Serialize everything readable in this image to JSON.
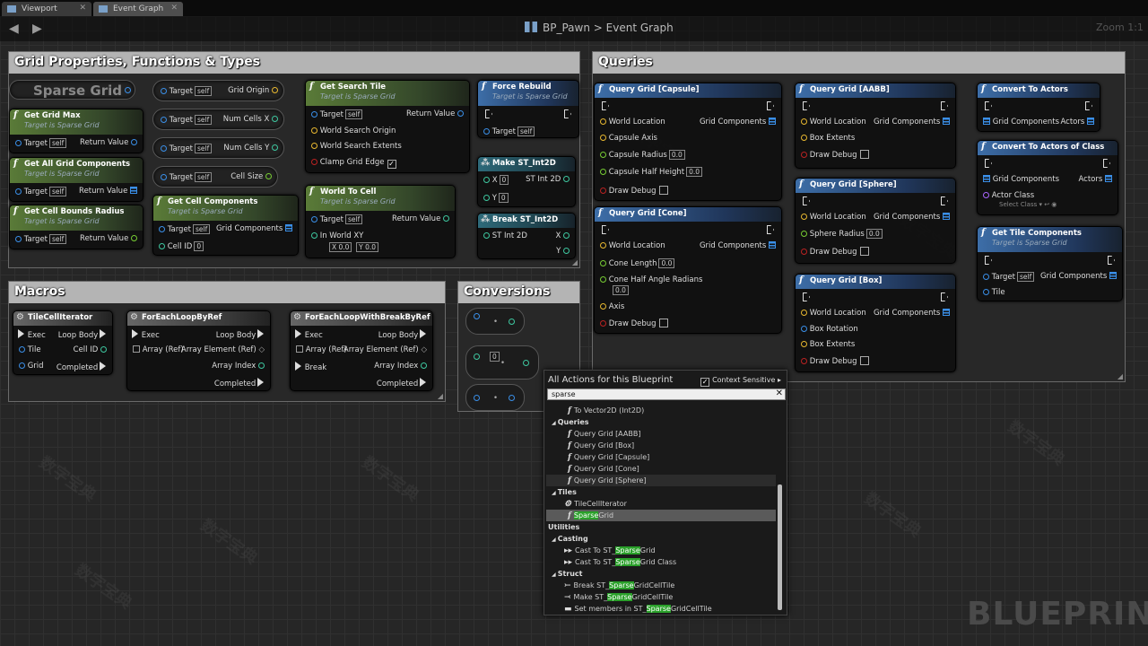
{
  "tabs": [
    {
      "label": "Viewport"
    },
    {
      "label": "Event Graph"
    }
  ],
  "breadcrumb": {
    "blueprint": "BP_Pawn",
    "separator": ">",
    "graph": "Event Graph"
  },
  "zoom": "Zoom 1:1",
  "watermark": "BLUEPRINT",
  "comments": {
    "grid": "Grid Properties, Functions & Types",
    "queries": "Queries",
    "macros": "Macros",
    "conversions": "Conversions"
  },
  "common": {
    "target": "Target",
    "self": "self",
    "return_value": "Return Value",
    "target_is": "Target is Sparse Grid",
    "exec": "Exec",
    "loop_body": "Loop Body",
    "completed": "Completed",
    "world_location": "World Location",
    "grid_components": "Grid Components",
    "draw_debug": "Draw Debug",
    "actors": "Actors"
  },
  "nodes": {
    "sparse_grid": "Sparse Grid",
    "get_grid_max": "Get Grid Max",
    "get_all_grid_components": "Get All Grid Components",
    "get_cell_bounds_radius": "Get Cell Bounds Radius",
    "grid_origin": "Grid Origin",
    "num_cells_x": "Num Cells X",
    "num_cells_y": "Num Cells Y",
    "cell_size": "Cell Size",
    "get_cell_components": "Get Cell Components",
    "cell_id": "Cell ID",
    "cell_id_val": "0",
    "get_search_tile": "Get Search Tile",
    "world_search_origin": "World Search Origin",
    "world_search_extents": "World Search Extents",
    "clamp_grid_edge": "Clamp Grid Edge",
    "world_to_cell": "World To Cell",
    "in_world_xy": "In World XY",
    "x_label": "X",
    "y_label": "Y",
    "x_val": "0.0",
    "y_val": "0.0",
    "force_rebuild": "Force Rebuild",
    "make_st_int2d": "Make ST_Int2D",
    "st_int2d": "ST Int 2D",
    "zero": "0",
    "break_st_int2d": "Break ST_Int2D",
    "qg_capsule": "Query Grid [Capsule]",
    "capsule_axis": "Capsule Axis",
    "capsule_radius": "Capsule Radius",
    "capsule_half_height": "Capsule Half Height",
    "zero_f": "0.0",
    "qg_cone": "Query Grid [Cone]",
    "cone_length": "Cone Length",
    "cone_half_angle": "Cone Half Angle Radians",
    "axis": "Axis",
    "qg_aabb": "Query Grid [AABB]",
    "box_extents": "Box Extents",
    "qg_sphere": "Query Grid [Sphere]",
    "sphere_radius": "Sphere Radius",
    "qg_box": "Query Grid [Box]",
    "box_rotation": "Box Rotation",
    "convert_to_actors": "Convert To Actors",
    "convert_to_actors_class": "Convert To Actors of Class",
    "actor_class": "Actor Class",
    "select_class": "Select Class",
    "get_tile_components": "Get Tile Components",
    "tile": "Tile",
    "tile_cell_iterator": "TileCellIterator",
    "cell_id2": "Cell ID",
    "grid": "Grid",
    "foreach_byref": "ForEachLoopByRef",
    "array_ref": "Array (Ref)",
    "array_element_ref": "Array Element (Ref)",
    "array_index": "Array Index",
    "foreach_break_byref": "ForEachLoopWithBreakByRef",
    "break": "Break",
    "conv_zero": "0"
  },
  "menu": {
    "title": "All Actions for this Blueprint",
    "context_sensitive": "Context Sensitive",
    "search_value": "sparse",
    "items": [
      {
        "text": "To Vector2D (Int2D)",
        "type": "fn"
      },
      {
        "text": "Queries",
        "type": "cat"
      },
      {
        "text": "Query Grid [AABB]",
        "type": "fn"
      },
      {
        "text": "Query Grid [Box]",
        "type": "fn"
      },
      {
        "text": "Query Grid [Capsule]",
        "type": "fn"
      },
      {
        "text": "Query Grid [Cone]",
        "type": "fn"
      },
      {
        "text": "Query Grid [Sphere]",
        "type": "fn"
      },
      {
        "text": "Tiles",
        "type": "cat"
      },
      {
        "text": "TileCellIterator",
        "type": "macro"
      },
      {
        "pre": "",
        "hl": "Sparse",
        "post": "Grid",
        "type": "fn"
      },
      {
        "text": "Utilities",
        "type": "cat"
      },
      {
        "text": "Casting",
        "type": "cat"
      },
      {
        "pre": "Cast To ST_",
        "hl": "Sparse",
        "post": "Grid",
        "type": "cast"
      },
      {
        "pre": "Cast To ST_",
        "hl": "Sparse",
        "post": "Grid Class",
        "type": "cast"
      },
      {
        "text": "Struct",
        "type": "cat"
      },
      {
        "pre": "Break ST_",
        "hl": "Sparse",
        "post": "GridCellTile",
        "type": "break"
      },
      {
        "pre": "Make ST_",
        "hl": "Sparse",
        "post": "GridCellTile",
        "type": "make"
      },
      {
        "pre": "Set members in ST_",
        "hl": "Sparse",
        "post": "GridCellTile",
        "type": "set"
      }
    ]
  }
}
